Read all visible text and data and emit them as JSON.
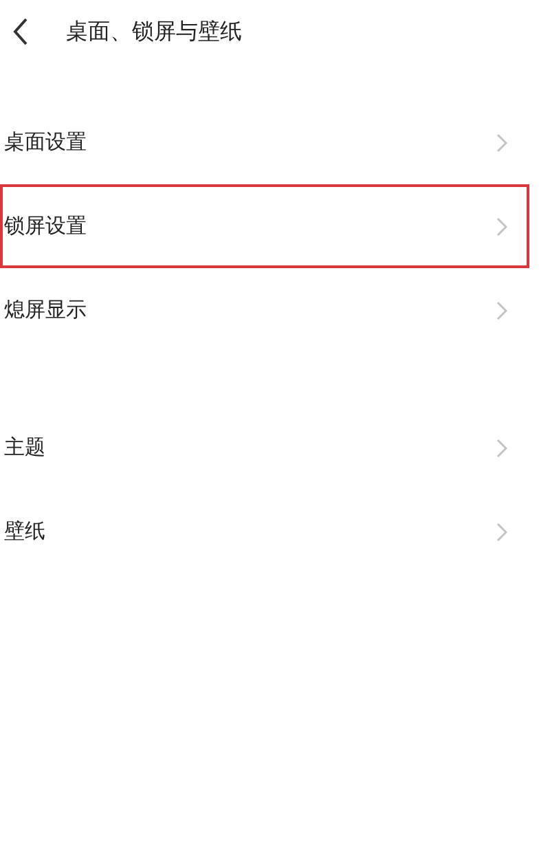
{
  "header": {
    "title": "桌面、锁屏与壁纸"
  },
  "groups": [
    {
      "items": [
        {
          "label": "桌面设置",
          "highlighted": false
        },
        {
          "label": "锁屏设置",
          "highlighted": true
        },
        {
          "label": "熄屏显示",
          "highlighted": false
        }
      ]
    },
    {
      "items": [
        {
          "label": "主题",
          "highlighted": false
        },
        {
          "label": "壁纸",
          "highlighted": false
        }
      ]
    }
  ]
}
